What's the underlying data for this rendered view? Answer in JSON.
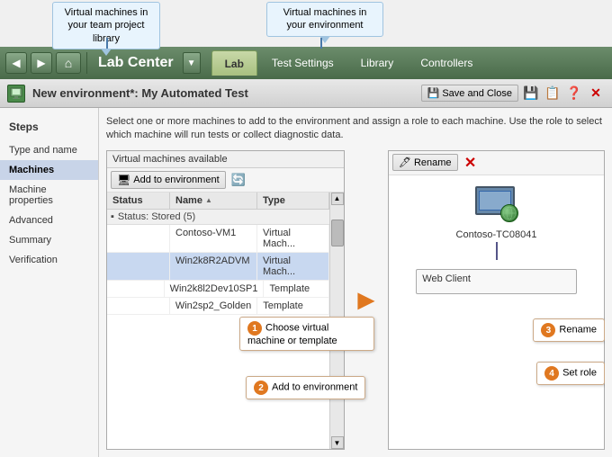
{
  "callouts": {
    "top_left": "Virtual machines in your team project library",
    "top_right": "Virtual machines in your environment"
  },
  "navbar": {
    "title": "Lab Center",
    "tabs": [
      {
        "label": "Lab",
        "active": true
      },
      {
        "label": "Test Settings",
        "active": false
      },
      {
        "label": "Library",
        "active": false
      },
      {
        "label": "Controllers",
        "active": false
      }
    ]
  },
  "window": {
    "title": "New environment*: My Automated Test",
    "save_close": "Save and Close"
  },
  "sidebar": {
    "heading": "Steps",
    "items": [
      {
        "label": "Type and name",
        "active": false
      },
      {
        "label": "Machines",
        "active": true
      },
      {
        "label": "Machine properties",
        "active": false
      },
      {
        "label": "Advanced",
        "active": false
      },
      {
        "label": "Summary",
        "active": false
      },
      {
        "label": "Verification",
        "active": false
      }
    ]
  },
  "description": "Select one or more machines to add to the environment and assign a role to each machine. Use the role to select which machine will run tests or collect diagnostic data.",
  "left_panel": {
    "header": "Virtual machines available",
    "toolbar_btn": "Add to environment",
    "table": {
      "columns": [
        "Status",
        "Name",
        "Type"
      ],
      "group_label": "Status: Stored (5)",
      "rows": [
        {
          "name": "Contoso-VM1",
          "type": "Virtual Mach...",
          "selected": false
        },
        {
          "name": "Win2k8R2ADVM",
          "type": "Virtual Mach...",
          "selected": true
        },
        {
          "name": "Win2k8l2Dev10SP1",
          "type": "Template",
          "selected": false
        },
        {
          "name": "Win2sp2_Golden",
          "type": "Template",
          "selected": false
        }
      ]
    }
  },
  "right_panel": {
    "rename_btn": "Rename",
    "vm_name": "Contoso-TC08041",
    "vm_role": "Web Client",
    "connector_visible": true
  },
  "step_callouts": [
    {
      "number": "1",
      "text": "Choose virtual machine or template"
    },
    {
      "number": "2",
      "text": "Add to environment"
    },
    {
      "number": "3",
      "text": "Rename"
    },
    {
      "number": "4",
      "text": "Set role"
    }
  ]
}
